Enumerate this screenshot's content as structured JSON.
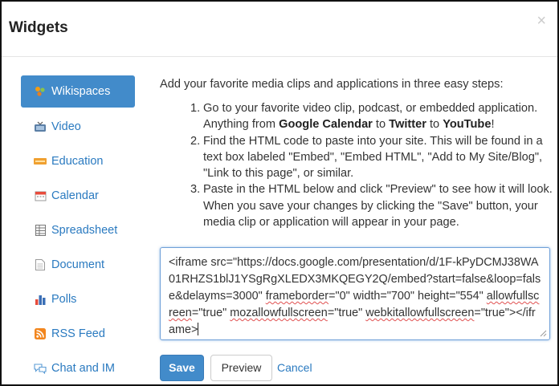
{
  "dialog": {
    "title": "Widgets",
    "close_glyph": "×",
    "close_icon": "close-icon"
  },
  "sidebar": {
    "items": [
      {
        "label": "Wikispaces",
        "icon": "wikispaces-icon",
        "active": true
      },
      {
        "label": "Video",
        "icon": "tv-icon",
        "active": false
      },
      {
        "label": "Education",
        "icon": "new-badge-icon",
        "active": false
      },
      {
        "label": "Calendar",
        "icon": "calendar-icon",
        "active": false
      },
      {
        "label": "Spreadsheet",
        "icon": "spreadsheet-icon",
        "active": false
      },
      {
        "label": "Document",
        "icon": "document-icon",
        "active": false
      },
      {
        "label": "Polls",
        "icon": "bar-chart-icon",
        "active": false
      },
      {
        "label": "RSS Feed",
        "icon": "rss-icon",
        "active": false
      },
      {
        "label": "Chat and IM",
        "icon": "chat-icon",
        "active": false
      }
    ]
  },
  "content": {
    "intro": "Add your favorite media clips and applications in three easy steps:",
    "steps": [
      {
        "num": "1.",
        "pre": "Go to your favorite video clip, podcast, or embedded application. Anything from ",
        "b1": "Google Calendar",
        "mid1": " to ",
        "b2": "Twitter",
        "mid2": " to ",
        "b3": "YouTube",
        "post": "!"
      },
      {
        "num": "2.",
        "text": "Find the HTML code to paste into your site. This will be found in a text box labeled \"Embed\", \"Embed HTML\", \"Add to My Site/Blog\", \"Link to this page\", or similar."
      },
      {
        "num": "3.",
        "text": "Paste in the HTML below and click \"Preview\" to see how it will look. When you save your changes by clicking the \"Save\" button, your media clip or application will appear in your page."
      }
    ],
    "code": {
      "part1": "<iframe src=\"https://docs.google.com/presentation/d/1F-kPyDCMJ38WA01RHZS1blJ1YSgRgXLEDX3MKQEGY2Q/embed?start=false&loop=false&delayms=3000\" ",
      "sq1": "frameborder",
      "part2": "=\"0\" width=\"700\" height=\"554\" ",
      "sq2": "allowfullscreen",
      "part3": "=\"true\" ",
      "sq3": "mozallowfullscreen",
      "part4": "=\"true\" ",
      "sq4": "webkitallowfullscreen",
      "part5": "=\"true\"></iframe>"
    }
  },
  "actions": {
    "save_label": "Save",
    "preview_label": "Preview",
    "cancel_label": "Cancel"
  },
  "colors": {
    "accent": "#428bca",
    "link": "#2a7ac0",
    "text": "#333333"
  }
}
